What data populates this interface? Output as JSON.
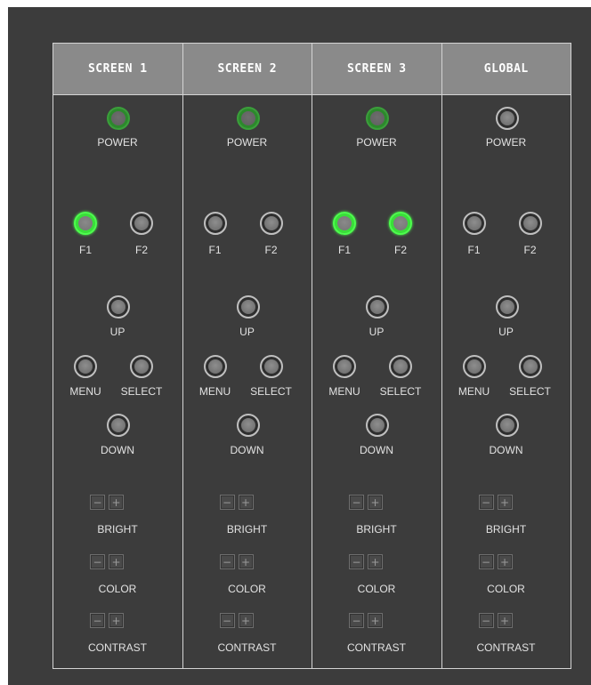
{
  "columns": [
    {
      "header": "SCREEN 1",
      "power": {
        "label": "POWER",
        "state": "on"
      },
      "f1": {
        "label": "F1",
        "state": "active"
      },
      "f2": {
        "label": "F2",
        "state": "off"
      },
      "up_label": "UP",
      "menu_label": "MENU",
      "select_label": "SELECT",
      "down_label": "DOWN",
      "bright_label": "BRIGHT",
      "color_label": "COLOR",
      "contrast_label": "CONTRAST",
      "minus": "−",
      "plus": "+"
    },
    {
      "header": "SCREEN 2",
      "power": {
        "label": "POWER",
        "state": "on"
      },
      "f1": {
        "label": "F1",
        "state": "off"
      },
      "f2": {
        "label": "F2",
        "state": "off"
      },
      "up_label": "UP",
      "menu_label": "MENU",
      "select_label": "SELECT",
      "down_label": "DOWN",
      "bright_label": "BRIGHT",
      "color_label": "COLOR",
      "contrast_label": "CONTRAST",
      "minus": "−",
      "plus": "+"
    },
    {
      "header": "SCREEN 3",
      "power": {
        "label": "POWER",
        "state": "on"
      },
      "f1": {
        "label": "F1",
        "state": "active"
      },
      "f2": {
        "label": "F2",
        "state": "active"
      },
      "up_label": "UP",
      "menu_label": "MENU",
      "select_label": "SELECT",
      "down_label": "DOWN",
      "bright_label": "BRIGHT",
      "color_label": "COLOR",
      "contrast_label": "CONTRAST",
      "minus": "−",
      "plus": "+"
    },
    {
      "header": "GLOBAL",
      "power": {
        "label": "POWER",
        "state": "off"
      },
      "f1": {
        "label": "F1",
        "state": "off"
      },
      "f2": {
        "label": "F2",
        "state": "off"
      },
      "up_label": "UP",
      "menu_label": "MENU",
      "select_label": "SELECT",
      "down_label": "DOWN",
      "bright_label": "BRIGHT",
      "color_label": "COLOR",
      "contrast_label": "CONTRAST",
      "minus": "−",
      "plus": "+"
    }
  ],
  "colors": {
    "background": "#3c3c3c",
    "header": "#8a8a8a",
    "border": "#d4d4d4",
    "led_on": "#3aa03a",
    "led_active": "#4cff4c",
    "led_off": "#bfbfbf"
  }
}
